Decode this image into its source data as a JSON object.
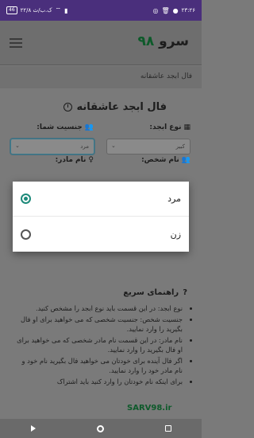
{
  "status_bar": {
    "time": "۲۳:۲۶",
    "speed": "۲۲/۸ ک.ب/ث",
    "battery": "46"
  },
  "app": {
    "logo_text": "سرو",
    "logo_number": "۹۸"
  },
  "breadcrumb": "فال ابجد عاشقانه",
  "form": {
    "title": "فال ابجد عاشقانه",
    "abjad_type_label": "نوع ابجد:",
    "abjad_type_value": "کبیر",
    "gender_label": "جنسیت شما:",
    "gender_value": "مرد",
    "person_name_label": "نام شخص:",
    "mother_name_label": "نام مادر:"
  },
  "dialog": {
    "options": [
      {
        "label": "مرد",
        "checked": true
      },
      {
        "label": "زن",
        "checked": false
      }
    ]
  },
  "help": {
    "title": "راهنمای سریع",
    "items": [
      "نوع ابجد: در این قسمت باید نوع ابجد را مشخص کنید.",
      "جنسیت شخص: جنسیت شخصی که می خواهید برای او فال بگیرید را وارد نمایید.",
      "نام مادر: در این قسمت نام مادر شخصی که می خواهید برای او فال بگیرید را وارد نمایید.",
      "اگر فال آینده برای خودتان می خواهید فال بگیرید نام خود و نام مادر خود را وارد نمایید.",
      "برای اینکه نام خودتان را وارد کنید باید اشتراک"
    ]
  },
  "watermark": "SARV98.ir",
  "colors": {
    "accent": "#1e8a7a",
    "status_bar": "#4a2f7c",
    "brand_green": "#0d5a2a"
  }
}
